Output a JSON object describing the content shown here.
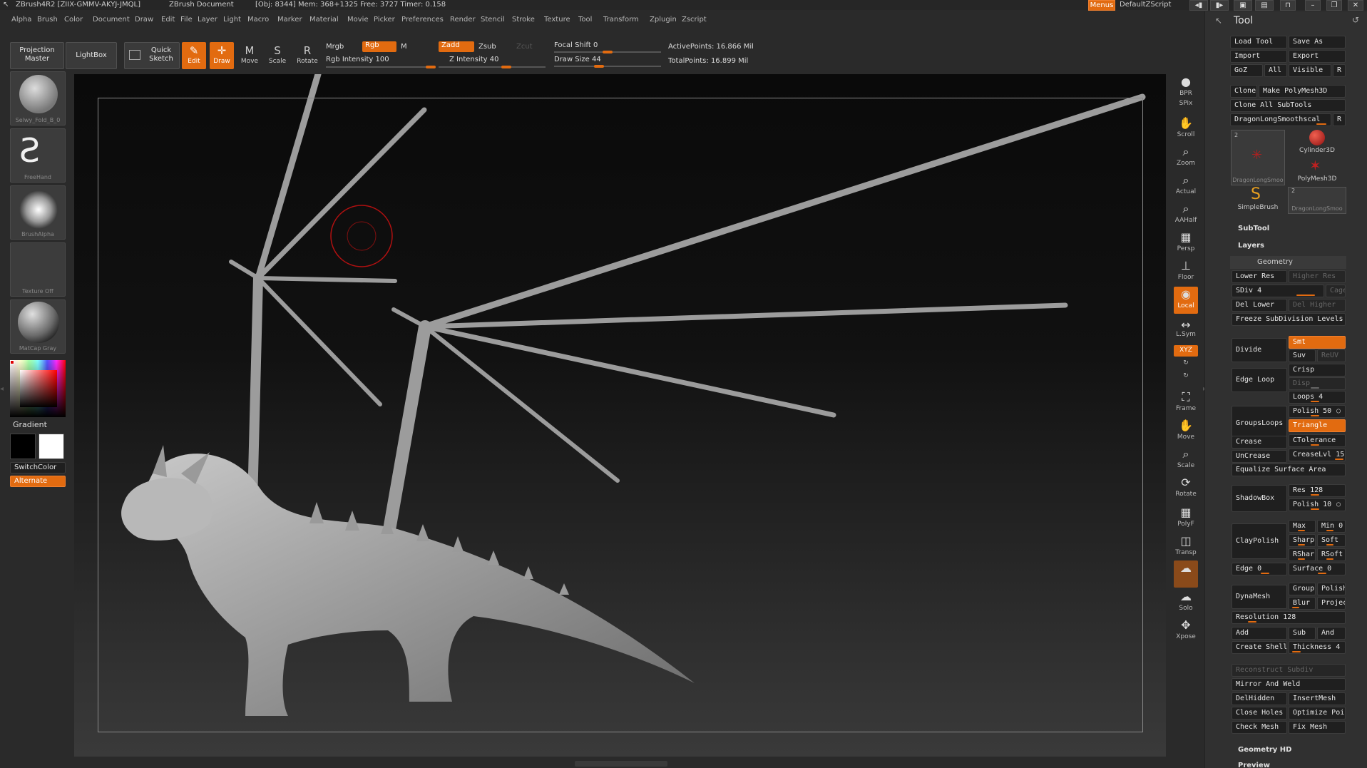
{
  "title_bar": {
    "app_title": "ZBrush4R2 [ZIIX-GMMV-AKYJ-JMQL]",
    "document": "ZBrush Document",
    "stats": "[Obj: 8344] Mem: 368+1325 Free: 3727 Timer: 0.158",
    "menus_button": "Menus",
    "script_name": "DefaultZScript"
  },
  "menu_bar": [
    "Alpha",
    "Brush",
    "Color",
    "Document",
    "Draw",
    "Edit",
    "File",
    "Layer",
    "Light",
    "Macro",
    "Marker",
    "Material",
    "Movie",
    "Picker",
    "Preferences",
    "Render",
    "Stencil",
    "Stroke",
    "Texture",
    "Tool",
    "Transform",
    "Zplugin",
    "Zscript"
  ],
  "toolbar": {
    "projection_master": "Projection Master",
    "lightbox": "LightBox",
    "quick_sketch": "Quick Sketch",
    "edit": "Edit",
    "draw": "Draw",
    "move": "Move",
    "scale": "Scale",
    "rotate": "Rotate",
    "mrgb": "Mrgb",
    "rgb": "Rgb",
    "m": "M",
    "rgb_intensity": "Rgb Intensity 100",
    "zadd": "Zadd",
    "zsub": "Zsub",
    "zcut": "Zcut",
    "z_intensity": "Z Intensity 40",
    "focal_shift": "Focal Shift 0",
    "draw_size": "Draw Size 44",
    "active_points": "ActivePoints: 16.866 Mil",
    "total_points": "TotalPoints: 16.899 Mil"
  },
  "left_shelf": {
    "brush_thumb": "Selwy_Fold_B_0",
    "stroke_thumb": "FreeHand",
    "alpha_thumb": "BrushAlpha",
    "texture_thumb": "Texture Off",
    "material_thumb": "MatCap Gray",
    "gradient": "Gradient",
    "switch_color": "SwitchColor",
    "alternate": "Alternate"
  },
  "right_shelf": [
    "BPR",
    "SPix",
    "Scroll",
    "Zoom",
    "Actual",
    "AAHalf",
    "Persp",
    "Floor",
    "Local",
    "L.Sym",
    "XYZ",
    "",
    "",
    "Frame",
    "Move",
    "Scale",
    "Rotate",
    "PolyF",
    "Transp",
    "",
    "Solo",
    "Xpose"
  ],
  "tool_panel": {
    "title": "Tool",
    "load_tool": "Load Tool",
    "save_as": "Save As",
    "import": "Import",
    "export": "Export",
    "goz": "GoZ",
    "all": "All",
    "visible": "Visible",
    "r": "R",
    "clone": "Clone",
    "make_polymesh": "Make PolyMesh3D",
    "clone_all_subtools": "Clone All SubTools",
    "current_tool": "DragonLongSmoothscal",
    "tool_thumbs": [
      {
        "label": "DragonLongSmoo",
        "count": "2"
      },
      {
        "label": "Cylinder3D"
      },
      {
        "label": "PolyMesh3D"
      },
      {
        "label": "SimpleBrush"
      },
      {
        "label": "DragonLongSmoo",
        "count": "2"
      }
    ],
    "subtool": "SubTool",
    "layers": "Layers",
    "geometry": "Geometry",
    "lower_res": "Lower Res",
    "higher_res": "Higher Res",
    "sdiv": "SDiv 4",
    "cage": "Cage",
    "del_lower": "Del Lower",
    "del_higher": "Del Higher",
    "freeze_subdiv": "Freeze SubDivision Levels",
    "divide": "Divide",
    "smt": "Smt",
    "suv": "Suv",
    "reuv": "ReUV",
    "edge_loop": "Edge Loop",
    "crisp": "Crisp",
    "disp": "Disp",
    "loops": "Loops 4",
    "groups_loops": "GroupsLoops",
    "polish": "Polish 50",
    "triangle": "Triangle",
    "crease": "Crease",
    "ctolerance": "CTolerance",
    "uncrease": "UnCrease",
    "creaselvl": "CreaseLvl 15",
    "equalize": "Equalize Surface Area",
    "shadowbox": "ShadowBox",
    "res": "Res 128",
    "polish_sb": "Polish 10",
    "claypolish": "ClayPolish",
    "max": "Max",
    "min": "Min 0",
    "sharp": "Sharp",
    "soft": "Soft",
    "rshar": "RShar",
    "rsoft": "RSoft",
    "edge": "Edge 0",
    "surface": "Surface 0",
    "dynamesh": "DynaMesh",
    "group": "Group",
    "polish_dm": "Polish",
    "blur": "Blur",
    "project": "Projec",
    "resolution": "Resolution 128",
    "add": "Add",
    "sub": "Sub",
    "and": "And",
    "create_shell": "Create Shell",
    "thickness": "Thickness 4",
    "reconstruct_subdiv": "Reconstruct Subdiv",
    "mirror_and_weld": "Mirror And Weld",
    "delhidden": "DelHidden",
    "insertmesh": "InsertMesh",
    "close_holes": "Close Holes",
    "optimize_points": "Optimize Poi",
    "check_mesh": "Check Mesh",
    "fix_mesh": "Fix Mesh",
    "geometry_hd": "Geometry HD",
    "preview": "Preview"
  },
  "colors": {
    "accent": "#e26b10",
    "panel": "#303030",
    "viewport": "#0d0d0d"
  }
}
